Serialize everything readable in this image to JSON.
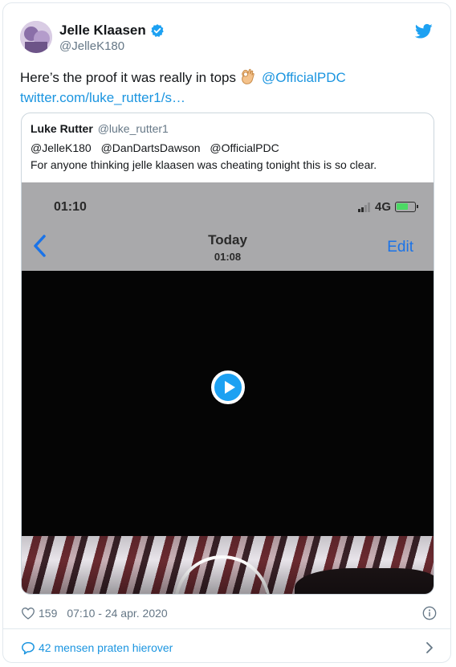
{
  "tweet": {
    "author_name": "Jelle Klaasen",
    "author_handle": "@JelleK180",
    "text_before": "Here’s the proof it was really in tops",
    "text_mention": "@OfficialPDC",
    "text_link": "twitter.com/luke_rutter1/s…",
    "likes": "159",
    "timestamp": "07:10 - 24 apr. 2020",
    "replies_label": "42 mensen praten hierover"
  },
  "quote": {
    "name": "Luke Rutter",
    "handle": "@luke_rutter1",
    "mentions": [
      "@JelleK180",
      "@DanDartsDawson",
      "@OfficialPDC"
    ],
    "text": "For anyone thinking jelle klaasen was cheating tonight this is so clear."
  },
  "media": {
    "status_time": "01:10",
    "network": "4G",
    "nav_title": "Today",
    "nav_subtitle": "01:08",
    "edit_label": "Edit"
  },
  "colors": {
    "link": "#1b95e0",
    "twitter_blue": "#1da1f2",
    "battery_green": "#4cd964"
  },
  "icons": [
    "verified-badge-icon",
    "twitter-bird-icon",
    "ok-hand-emoji-icon",
    "play-icon",
    "heart-icon",
    "info-icon",
    "comment-bubble-icon",
    "chevron-right-icon",
    "back-chevron-icon"
  ]
}
